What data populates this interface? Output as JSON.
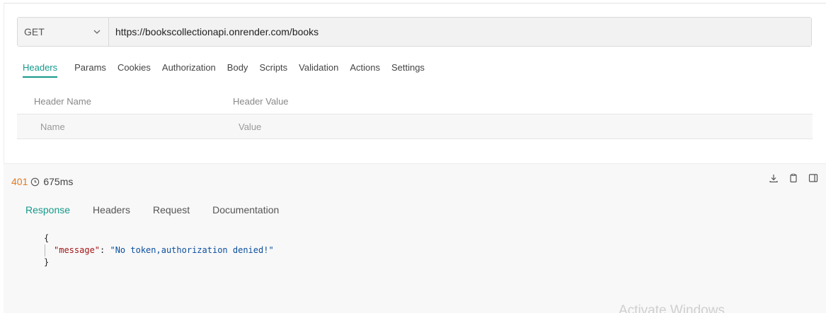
{
  "request": {
    "method": "GET",
    "url": "https://bookscollectionapi.onrender.com/books"
  },
  "request_tabs": [
    {
      "label": "Headers",
      "active": true
    },
    {
      "label": "Params",
      "active": false
    },
    {
      "label": "Cookies",
      "active": false
    },
    {
      "label": "Authorization",
      "active": false
    },
    {
      "label": "Body",
      "active": false
    },
    {
      "label": "Scripts",
      "active": false
    },
    {
      "label": "Validation",
      "active": false
    },
    {
      "label": "Actions",
      "active": false
    },
    {
      "label": "Settings",
      "active": false
    }
  ],
  "headers_table": {
    "col_name": "Header Name",
    "col_value": "Header Value",
    "placeholder_name": "Name",
    "placeholder_value": "Value"
  },
  "response": {
    "status_code": "401",
    "time": "675ms",
    "tabs": [
      {
        "label": "Response",
        "active": true
      },
      {
        "label": "Headers",
        "active": false
      },
      {
        "label": "Request",
        "active": false
      },
      {
        "label": "Documentation",
        "active": false
      }
    ],
    "body": {
      "open": "{",
      "key": "\"message\"",
      "sep": ": ",
      "value": "\"No token,authorization denied!\"",
      "close": "}"
    }
  },
  "icons": {
    "download": "download-icon",
    "copy": "clipboard-icon",
    "layout": "split-view-icon",
    "clock": "clock-icon",
    "chevron": "chevron-down-icon"
  },
  "colors": {
    "accent": "#15998a",
    "status_error": "#e07a26"
  },
  "watermark": "Activate Windows"
}
